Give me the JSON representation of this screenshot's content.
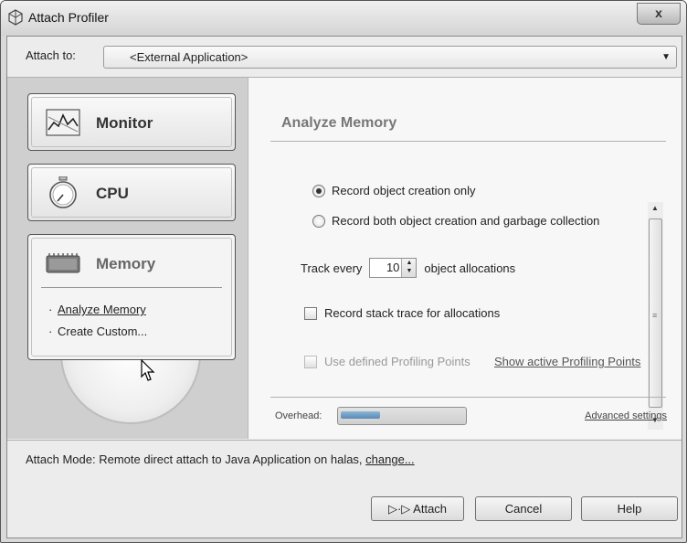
{
  "window": {
    "title": "Attach Profiler",
    "close_label": "x"
  },
  "attach": {
    "label": "Attach to:",
    "value": "<External Application>"
  },
  "modes": [
    {
      "label": "Monitor"
    },
    {
      "label": "CPU"
    },
    {
      "label": "Memory",
      "subitems": [
        "Analyze Memory",
        "Create Custom..."
      ]
    }
  ],
  "panel": {
    "title": "Analyze Memory",
    "radio_1": "Record object creation only",
    "radio_2": "Record both object creation and garbage collection",
    "track_prefix": "Track every",
    "track_value": "10",
    "track_suffix": "object allocations",
    "stack_trace_label": "Record stack trace for allocations",
    "profiling_points_label": "Use defined Profiling Points",
    "profiling_points_link": "Show active Profiling Points",
    "overhead_label": "Overhead:",
    "overhead_level": 0.32,
    "advanced_link": "Advanced settings"
  },
  "mode_line": {
    "text": "Attach Mode: Remote direct attach to Java Application on halas, ",
    "change_link": "change..."
  },
  "buttons": {
    "attach": "▷·▷ Attach",
    "cancel": "Cancel",
    "help": "Help"
  },
  "colors": {
    "overhead_fill": "#5c88b5"
  }
}
